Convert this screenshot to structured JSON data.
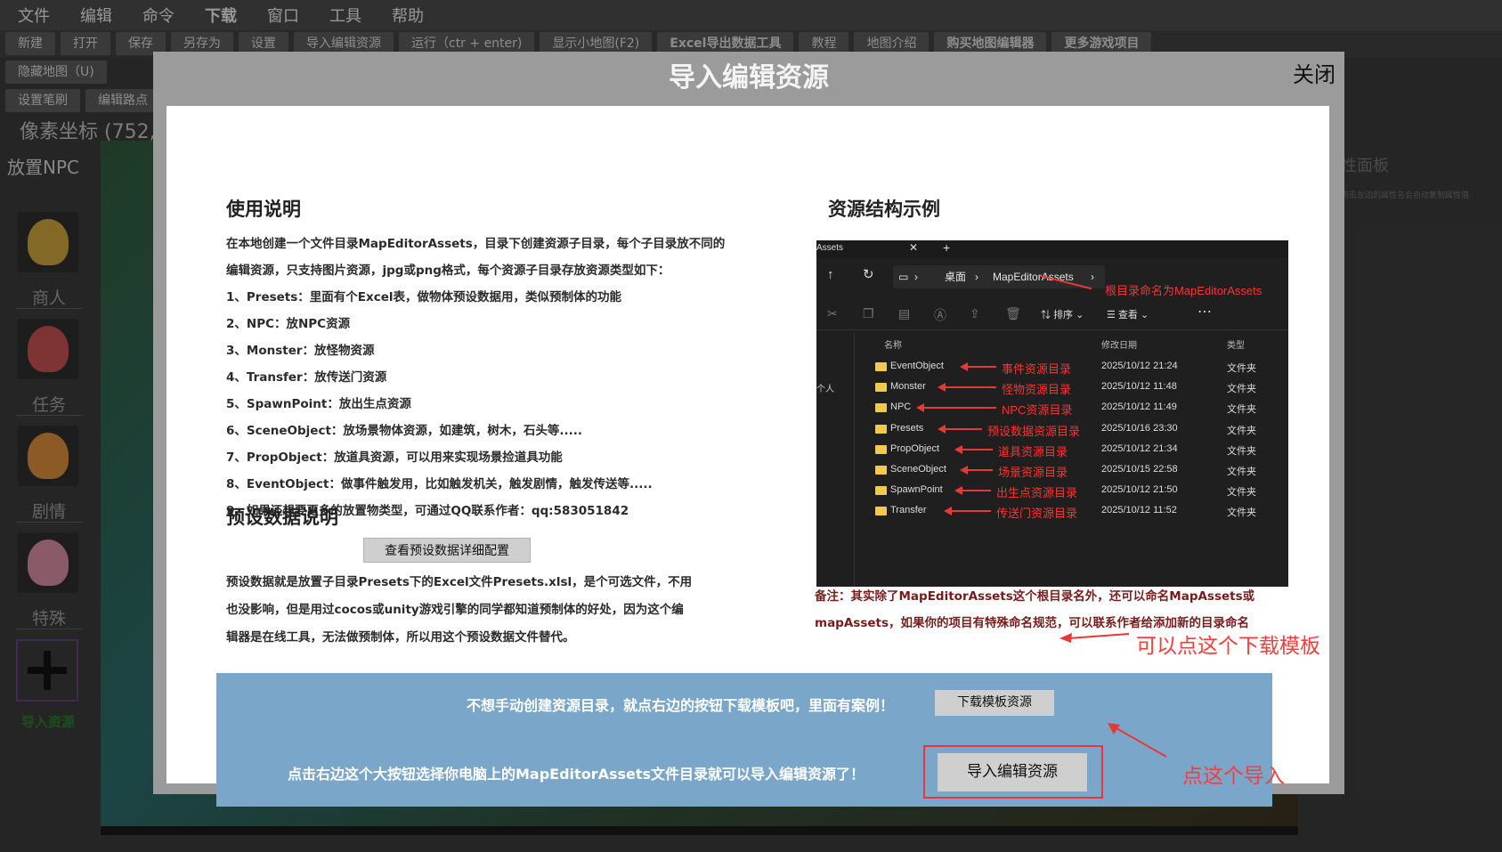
{
  "menu": [
    "文件",
    "编辑",
    "命令",
    "下载",
    "窗口",
    "工具",
    "帮助"
  ],
  "toolbar": [
    "新建",
    "打开",
    "保存",
    "另存为",
    "设置",
    "导入编辑资源",
    "运行（ctr + enter)",
    "显示小地图(F2)",
    "Excel导出数据工具",
    "教程",
    "地图介绍",
    "购买地图编辑器",
    "更多游戏项目"
  ],
  "toolbar_row2": [
    "隐藏地图（U)"
  ],
  "toolbar_row3": [
    "设置笔刷",
    "编辑路点"
  ],
  "coords_text": "像素坐标 (752,1",
  "left_panel": {
    "title": "放置NPC",
    "npcs": [
      {
        "label": "商人",
        "color": "#c9a13a"
      },
      {
        "label": "任务",
        "color": "#c0504d"
      },
      {
        "label": "剧情",
        "color": "#d88a3a"
      },
      {
        "label": "特殊",
        "color": "#d48aa0"
      }
    ],
    "add_label": "导入资源"
  },
  "right_panel": {
    "title": "性面板",
    "hint": "点击左边的属性名会自动复制属性值"
  },
  "modal": {
    "title": "导入编辑资源",
    "close": "关闭",
    "instructions": {
      "title": "使用说明",
      "lines": [
        "在本地创建一个文件目录MapEditorAssets，目录下创建资源子目录，每个子目录放不同的",
        "编辑资源，只支持图片资源，jpg或png格式，每个资源子目录存放资源类型如下：",
        "1、Presets：里面有个Excel表，做物体预设数据用，类似预制体的功能",
        "2、NPC：放NPC资源",
        "3、Monster：放怪物资源",
        "4、Transfer：放传送门资源",
        "5、SpawnPoint：放出生点资源",
        "6、SceneObject：放场景物体资源，如建筑，树木，石头等.....",
        "7、PropObject：放道具资源，可以用来实现场景捡道具功能",
        "8、EventObject：做事件触发用，比如触发机关，触发剧情，触发传送等.....",
        "9、如果还想要更多的放置物类型，可通过QQ联系作者：qq:583051842"
      ]
    },
    "preset": {
      "title": "预设数据说明",
      "button": "查看预设数据详细配置",
      "lines": [
        "预设数据就是放置子目录Presets下的Excel文件Presets.xlsl，是个可选文件，不用",
        "也没影响，但是用过cocos或unity游戏引擎的同学都知道预制体的好处，因为这个编",
        "辑器是在线工具，无法做预制体，所以用这个预设数据文件替代。"
      ]
    },
    "structure": {
      "title": "资源结构示例",
      "tab_label": "Assets",
      "breadcrumb_desktop": "桌面",
      "breadcrumb_folder": "MapEditorAssets",
      "root_annotation": "根目录命名为MapEditorAssets",
      "sort_label": "排序",
      "view_label": "查看",
      "col_name": "名称",
      "col_date": "修改日期",
      "col_type": "类型",
      "side_label": "个人",
      "rows": [
        {
          "name": "EventObject",
          "annotation": "事件资源目录",
          "date": "2025/10/12 21:24",
          "type": "文件夹"
        },
        {
          "name": "Monster",
          "annotation": "怪物资源目录",
          "date": "2025/10/12 11:48",
          "type": "文件夹"
        },
        {
          "name": "NPC",
          "annotation": "NPC资源目录",
          "date": "2025/10/12 11:49",
          "type": "文件夹"
        },
        {
          "name": "Presets",
          "annotation": "预设数据资源目录",
          "date": "2025/10/16 23:30",
          "type": "文件夹"
        },
        {
          "name": "PropObject",
          "annotation": "道具资源目录",
          "date": "2025/10/12 21:34",
          "type": "文件夹"
        },
        {
          "name": "SceneObject",
          "annotation": "场景资源目录",
          "date": "2025/10/15 22:58",
          "type": "文件夹"
        },
        {
          "name": "SpawnPoint",
          "annotation": "出生点资源目录",
          "date": "2025/10/12 21:50",
          "type": "文件夹"
        },
        {
          "name": "Transfer",
          "annotation": "传送门资源目录",
          "date": "2025/10/12 11:52",
          "type": "文件夹"
        }
      ],
      "note_lines": [
        "备注：其实除了MapEditorAssets这个根目录名外，还可以命名MapAssets或",
        "mapAssets，如果你的项目有特殊命名规范，可以联系作者给添加新的目录命名"
      ]
    },
    "download": {
      "text": "不想手动创建资源目录，就点右边的按钮下载模板吧，里面有案例！",
      "button": "下载模板资源",
      "annotation": "可以点这个下载模板"
    },
    "import": {
      "text": "点击右边这个大按钮选择你电脑上的MapEditorAssets文件目录就可以导入编辑资源了！",
      "button": "导入编辑资源",
      "annotation": "点这个导入"
    }
  }
}
